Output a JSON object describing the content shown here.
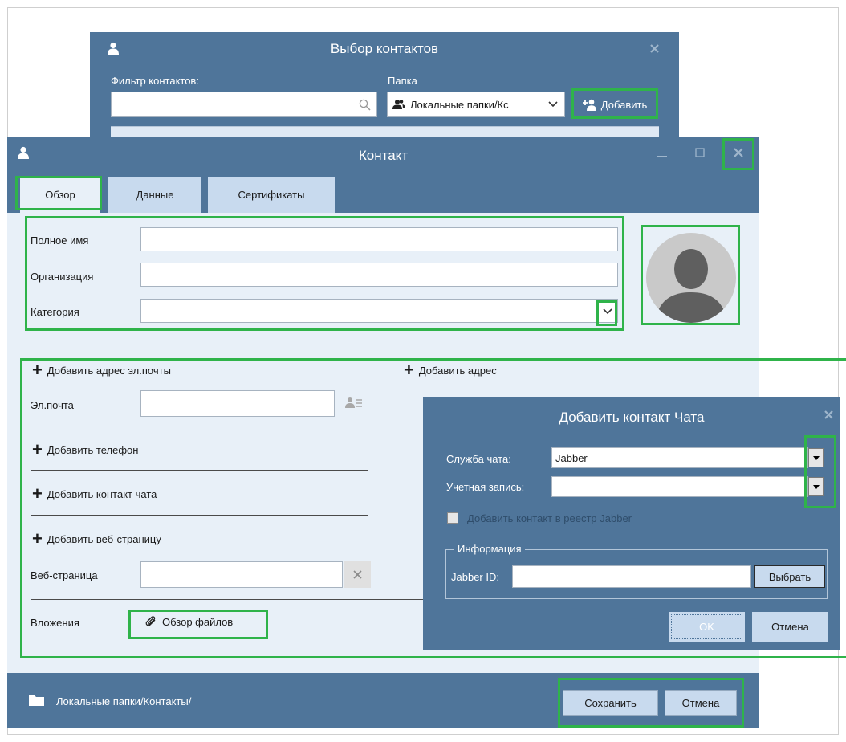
{
  "contact_picker": {
    "title": "Выбор контактов",
    "filter_label": "Фильтр контактов:",
    "filter_value": "",
    "folder_label": "Папка",
    "folder_value": "Локальные папки/Кс",
    "add_button": "Добавить"
  },
  "contact_window": {
    "title": "Контакт",
    "tabs": [
      {
        "label": "Обзор",
        "active": true
      },
      {
        "label": "Данные",
        "active": false
      },
      {
        "label": "Сертификаты",
        "active": false
      }
    ],
    "fields": {
      "full_name_label": "Полное имя",
      "full_name_value": "",
      "organization_label": "Организация",
      "organization_value": "",
      "category_label": "Категория",
      "category_value": ""
    },
    "links": {
      "add_email": "Добавить адрес эл.почты",
      "add_address": "Добавить адрес",
      "add_phone": "Добавить телефон",
      "add_chat": "Добавить контакт чата",
      "add_web": "Добавить веб-страницу"
    },
    "email_label": "Эл.почта",
    "email_value": "",
    "web_label": "Веб-страница",
    "web_value": "",
    "attachments_label": "Вложения",
    "browse_files": "Обзор файлов",
    "footer_path": "Локальные папки/Контакты/",
    "save_button": "Сохранить",
    "cancel_button": "Отмена"
  },
  "chat_dialog": {
    "title": "Добавить контакт Чата",
    "service_label": "Служба чата:",
    "service_value": "Jabber",
    "account_label": "Учетная запись:",
    "account_value": "",
    "roster_checkbox_label": "Добавить контакт в реестр Jabber",
    "roster_checked": false,
    "info_group_label": "Информация",
    "jabber_id_label": "Jabber ID:",
    "jabber_id_value": "",
    "select_button": "Выбрать",
    "ok_button": "OK",
    "cancel_button": "Отмена"
  },
  "colors": {
    "window_blue": "#4f759a",
    "panel_bg": "#e8f0f8",
    "tab_inactive": "#c8daee",
    "highlight_green": "#2fb34a"
  },
  "icons": [
    "person-icon",
    "close-icon",
    "search-icon",
    "contacts-folder-icon",
    "chevron-down-icon",
    "add-person-icon",
    "minimize-icon",
    "maximize-icon",
    "avatar-placeholder",
    "address-book-icon",
    "clear-icon",
    "paperclip-icon",
    "folder-icon",
    "dropdown-arrow-icon"
  ]
}
